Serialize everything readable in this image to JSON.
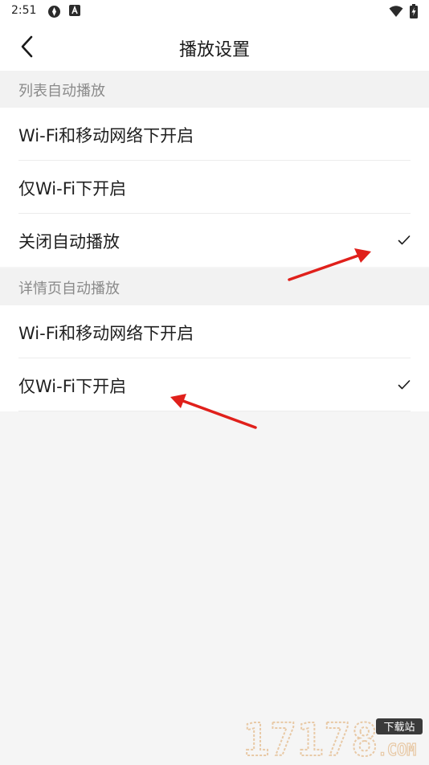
{
  "status_bar": {
    "time": "2:51",
    "icons_left": [
      "settings-app-icon",
      "a-app-icon"
    ],
    "icons_right": [
      "wifi-icon",
      "battery-charging-icon"
    ]
  },
  "header": {
    "title": "播放设置",
    "back_icon": "chevron-left-icon"
  },
  "sections": [
    {
      "title": "列表自动播放",
      "options": [
        {
          "label": "Wi-Fi和移动网络下开启",
          "selected": false
        },
        {
          "label": "仅Wi-Fi下开启",
          "selected": false
        },
        {
          "label": "关闭自动播放",
          "selected": true
        }
      ]
    },
    {
      "title": "详情页自动播放",
      "options": [
        {
          "label": "Wi-Fi和移动网络下开启",
          "selected": false
        },
        {
          "label": "仅Wi-Fi下开启",
          "selected": true
        }
      ]
    }
  ],
  "annotations": {
    "arrow_color": "#e0201b"
  },
  "watermark": {
    "number": "17178",
    "tag": "下载站",
    "domain": ".COM"
  },
  "colors": {
    "background": "#f5f5f5",
    "surface": "#ffffff",
    "section_text": "#8a8a8a",
    "primary_text": "#1f1f1f"
  }
}
